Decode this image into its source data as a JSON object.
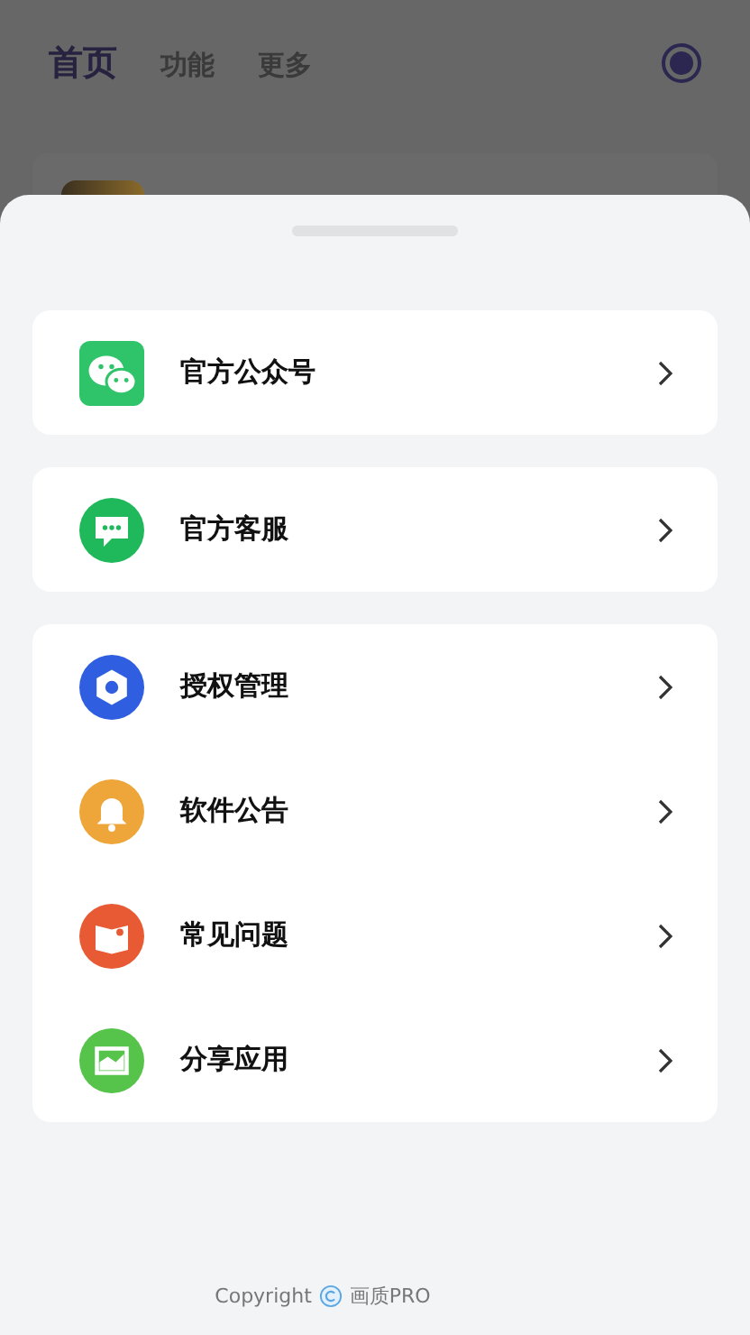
{
  "tabs": [
    {
      "label": "首页",
      "selected": true
    },
    {
      "label": "功能",
      "selected": false
    },
    {
      "label": "更多",
      "selected": false
    }
  ],
  "groups": [
    {
      "items": [
        {
          "label": "官方公众号",
          "kind": "wechat"
        }
      ]
    },
    {
      "items": [
        {
          "label": "官方客服",
          "kind": "chat"
        }
      ]
    },
    {
      "items": [
        {
          "label": "授权管理",
          "kind": "gear"
        },
        {
          "label": "软件公告",
          "kind": "bell"
        },
        {
          "label": "常见问题",
          "kind": "book"
        },
        {
          "label": "分享应用",
          "kind": "chart"
        }
      ]
    }
  ],
  "footer": {
    "prefix": "Copyright",
    "name": "画质PRO"
  }
}
